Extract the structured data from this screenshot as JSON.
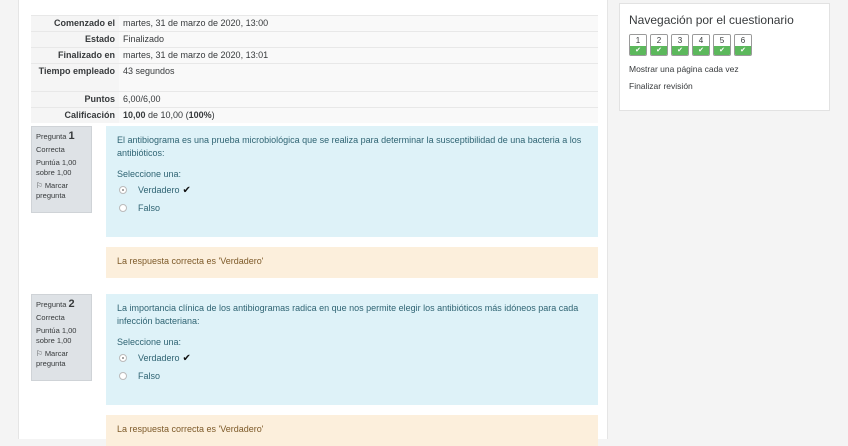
{
  "summary": [
    {
      "label": "Comenzado el",
      "value": "martes, 31 de marzo de 2020, 13:00"
    },
    {
      "label": "Estado",
      "value": "Finalizado"
    },
    {
      "label": "Finalizado en",
      "value": "martes, 31 de marzo de 2020, 13:01"
    },
    {
      "label": "Tiempo empleado",
      "value": "43 segundos"
    },
    {
      "label": "Puntos",
      "value": "6,00/6,00"
    },
    {
      "label": "Calificación",
      "grade_bold": "10,00",
      "grade_mid": " de 10,00 (",
      "grade_pct": "100%",
      "grade_end": ")"
    }
  ],
  "questions": [
    {
      "prefix": "Pregunta ",
      "number": "1",
      "state": "Correcta",
      "score": "Puntúa 1,00 sobre 1,00",
      "flag": "Marcar pregunta",
      "text": "El antibiograma es una prueba microbiológica que se realiza para determinar la susceptibilidad de una bacteria a los antibióticos:",
      "prompt": "Seleccione una:",
      "options": [
        "Verdadero",
        "Falso"
      ],
      "check": "✔",
      "feedback": "La respuesta correcta es 'Verdadero'"
    },
    {
      "prefix": "Pregunta ",
      "number": "2",
      "state": "Correcta",
      "score": "Puntúa 1,00 sobre 1,00",
      "flag": "Marcar pregunta",
      "text": "La importancia clínica de los antibiogramas radica en que nos permite elegir los antibióticos más idóneos para cada infección bacteriana:",
      "prompt": "Seleccione una:",
      "options": [
        "Verdadero",
        "Falso"
      ],
      "check": "✔",
      "feedback": "La respuesta correcta es 'Verdadero'"
    }
  ],
  "nav": {
    "title": "Navegación por el cuestionario",
    "buttons": [
      "1",
      "2",
      "3",
      "4",
      "5",
      "6"
    ],
    "status_icon": "✔",
    "one_page": "Mostrar una página cada vez",
    "finish": "Finalizar revisión"
  }
}
